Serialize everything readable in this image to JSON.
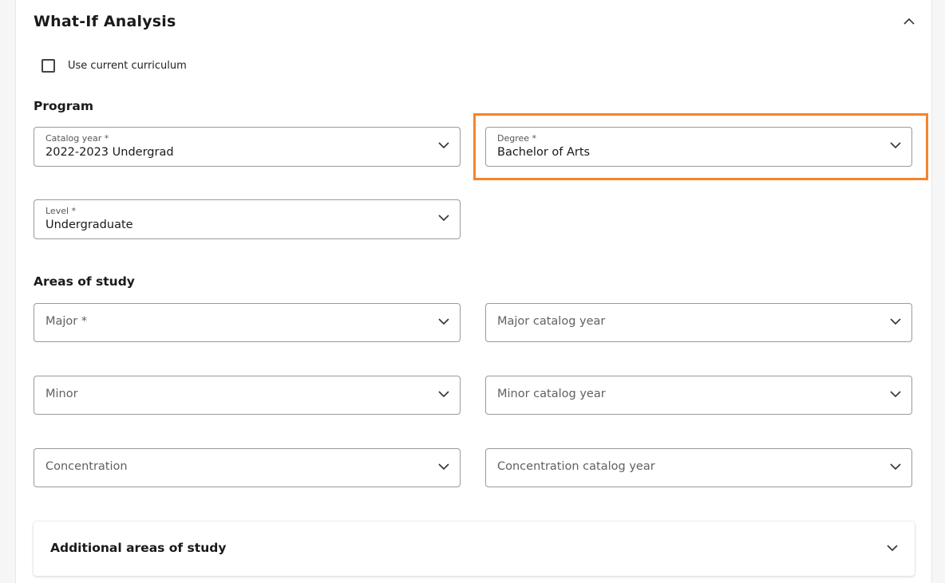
{
  "header": {
    "title": "What-If Analysis"
  },
  "options": {
    "use_current_curriculum_label": "Use current curriculum"
  },
  "program": {
    "heading": "Program",
    "catalog_year": {
      "label": "Catalog year *",
      "value": "2022-2023 Undergrad"
    },
    "degree": {
      "label": "Degree *",
      "value": "Bachelor of Arts"
    },
    "level": {
      "label": "Level *",
      "value": "Undergraduate"
    }
  },
  "areas_of_study": {
    "heading": "Areas of study",
    "major": {
      "placeholder": "Major *"
    },
    "major_catalog_year": {
      "placeholder": "Major catalog year"
    },
    "minor": {
      "placeholder": "Minor"
    },
    "minor_catalog_year": {
      "placeholder": "Minor catalog year"
    },
    "concentration": {
      "placeholder": "Concentration"
    },
    "concentration_catalog_year": {
      "placeholder": "Concentration catalog year"
    }
  },
  "additional": {
    "title": "Additional areas of study"
  },
  "colors": {
    "highlight": "#f5842a",
    "border": "#9a9a9a",
    "text": "#1a1a1a"
  },
  "icons": {
    "collapse": "chevron-up-icon",
    "dropdown": "chevron-down-icon",
    "checkbox": "checkbox-unchecked-icon"
  }
}
